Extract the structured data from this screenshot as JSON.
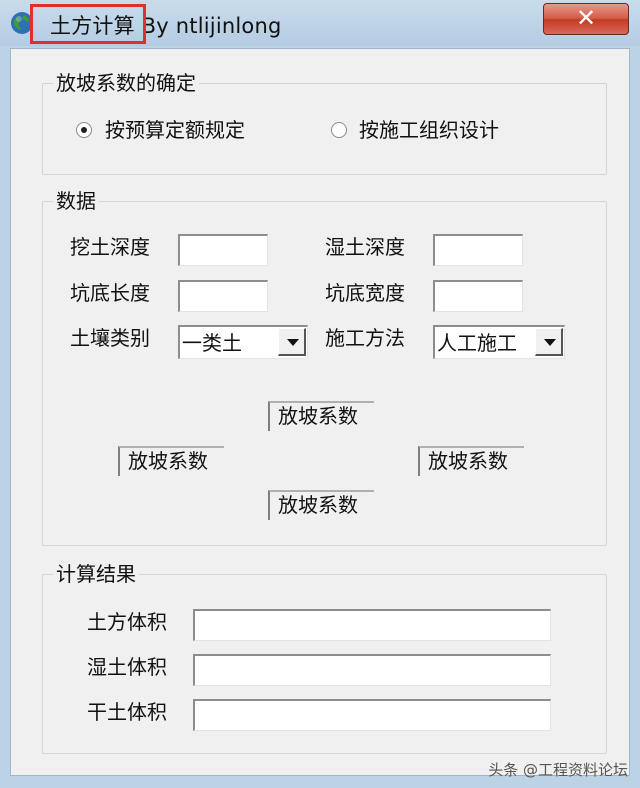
{
  "window": {
    "title": "土方计算 By ntlijinlong",
    "close_symbol": "✕"
  },
  "slope_group": {
    "label": "放坡系数的确定",
    "options": [
      "按预算定额规定",
      "按施工组织设计"
    ],
    "selected_index": 0
  },
  "data_group": {
    "label": "数据",
    "excavation_depth_label": "挖土深度",
    "wet_soil_depth_label": "湿土深度",
    "pit_length_label": "坑底长度",
    "pit_width_label": "坑底宽度",
    "soil_type_label": "土壤类别",
    "soil_type_value": "一类土",
    "method_label": "施工方法",
    "method_value": "人工施工",
    "slope_coef_top": "放坡系数",
    "slope_coef_left": "放坡系数",
    "slope_coef_right": "放坡系数",
    "slope_coef_bottom": "放坡系数"
  },
  "result_group": {
    "label": "计算结果",
    "earth_volume_label": "土方体积",
    "wet_volume_label": "湿土体积",
    "dry_volume_label": "干土体积"
  },
  "watermark": "头条 @工程资料论坛",
  "colors": {
    "highlight": "#e0302a",
    "close_button": "#c94a35",
    "title_bar": "#bcd3e6",
    "client_bg": "#f0f0f0"
  },
  "icons": [
    "globe-icon",
    "close-icon",
    "chevron-down-icon"
  ]
}
